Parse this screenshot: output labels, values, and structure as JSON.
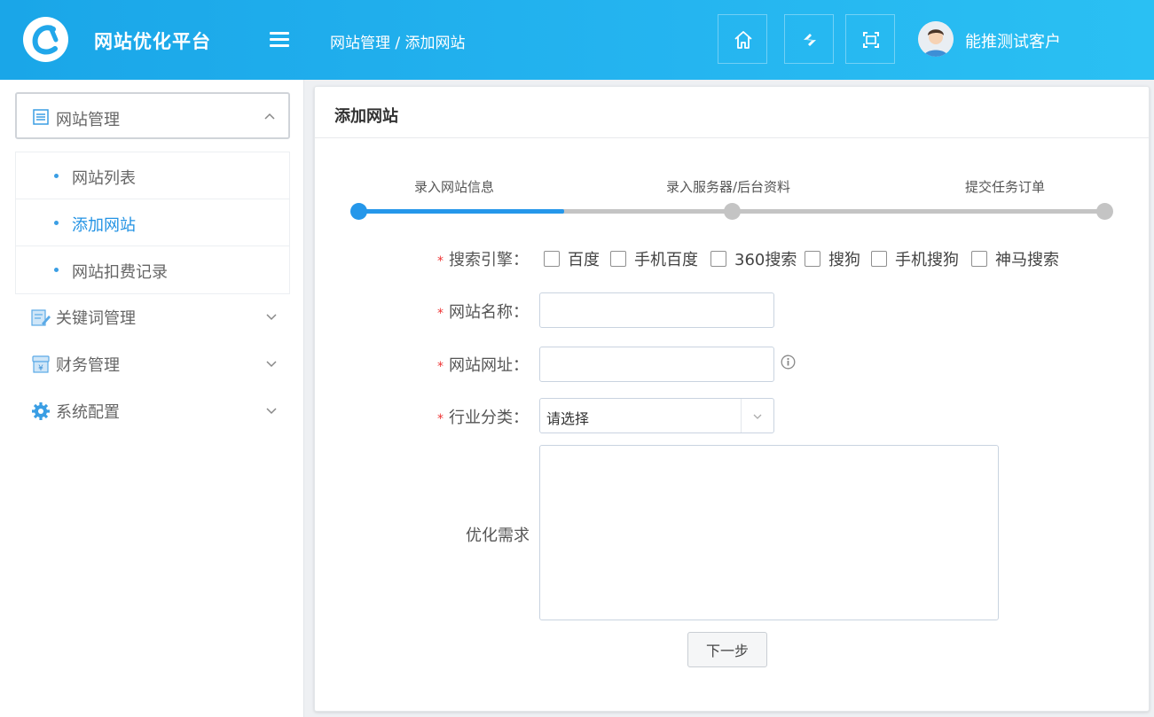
{
  "header": {
    "app_title": "网站优化平台",
    "breadcrumb": "网站管理 / 添加网站",
    "username": "能推测试客户",
    "icons": [
      "menu-icon",
      "home-icon",
      "refresh-icon",
      "fullscreen-icon"
    ]
  },
  "sidebar": {
    "section_title": "网站管理",
    "sub_items": [
      {
        "label": "网站列表",
        "active": false
      },
      {
        "label": "添加网站",
        "active": true
      },
      {
        "label": "网站扣费记录",
        "active": false
      }
    ],
    "menu": [
      {
        "label": "关键词管理",
        "icon": "edit-icon"
      },
      {
        "label": "财务管理",
        "icon": "wallet-icon"
      },
      {
        "label": "系统配置",
        "icon": "gear-icon"
      }
    ]
  },
  "panel": {
    "title": "添加网站",
    "steps": [
      {
        "label": "录入网站信息",
        "done": true
      },
      {
        "label": "录入服务器/后台资料",
        "done": false
      },
      {
        "label": "提交任务订单",
        "done": false
      }
    ],
    "step_progress": 0.275,
    "form": {
      "engine_label": "搜索引擎：",
      "engines": [
        "百度",
        "手机百度",
        "360搜索",
        "搜狗",
        "手机搜狗",
        "神马搜索"
      ],
      "name_label": "网站名称：",
      "url_label": "网站网址：",
      "industry_label": "行业分类：",
      "industry_value": "请选择",
      "demand_label": "优化需求",
      "required_mark": "*",
      "next_button": "下一步"
    }
  },
  "colors": {
    "header_gradient_start": "#1aa6e8",
    "header_gradient_end": "#2ac0f3",
    "accent": "#2597ea",
    "active_link": "#2393e4",
    "required": "#e33333"
  }
}
